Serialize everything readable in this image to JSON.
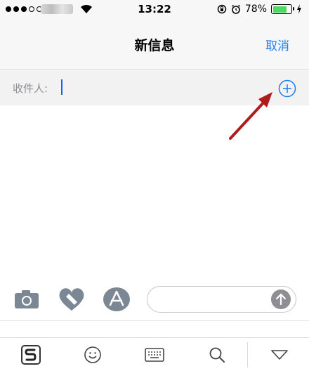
{
  "status_bar": {
    "time": "13:22",
    "battery": "78%",
    "battery_level": 0.78
  },
  "nav": {
    "title": "新信息",
    "cancel_label": "取消"
  },
  "recipient": {
    "label": "收件人:"
  },
  "colors": {
    "accent": "#1a7cf5",
    "arrow": "#b01c1c",
    "battery": "#4cd964"
  },
  "composer": {
    "icons": [
      "camera-icon",
      "heart-digital-touch-icon",
      "app-store-icon",
      "send-arrow-icon"
    ]
  },
  "keyboard_toolbar": {
    "icons": [
      "sogou-logo-icon",
      "emoji-icon",
      "keyboard-icon",
      "search-icon",
      "collapse-icon"
    ]
  }
}
